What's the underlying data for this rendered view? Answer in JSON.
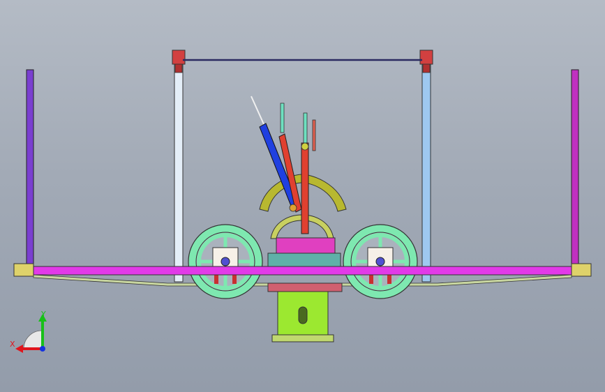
{
  "viewport": {
    "background_top": "#b4bbc5",
    "background_bottom": "#939caa"
  },
  "triad": {
    "x_label": "X",
    "y_label": "Y",
    "x_color": "#e0141c",
    "y_color": "#18c018",
    "z_color": "#1432e0"
  },
  "parts": [
    {
      "name": "left-side-panel",
      "color": "#7a3fd0"
    },
    {
      "name": "right-side-panel",
      "color": "#c030c0"
    },
    {
      "name": "left-tall-post",
      "color": "#e4eef8"
    },
    {
      "name": "right-tall-post",
      "color": "#9ec8f0"
    },
    {
      "name": "top-crossbar",
      "color": "#2a2a60"
    },
    {
      "name": "main-base-plate",
      "color": "#e23ae8"
    },
    {
      "name": "left-wheel",
      "color": "#7ee8b0"
    },
    {
      "name": "right-wheel",
      "color": "#7ee8b0"
    },
    {
      "name": "center-gear-arc",
      "color": "#b8b830"
    },
    {
      "name": "center-pink-block",
      "color": "#e040c0"
    },
    {
      "name": "blue-cylinder",
      "color": "#2040e0"
    },
    {
      "name": "red-lever",
      "color": "#e04030"
    },
    {
      "name": "bottom-mount-plate",
      "color": "#9ce830"
    }
  ]
}
